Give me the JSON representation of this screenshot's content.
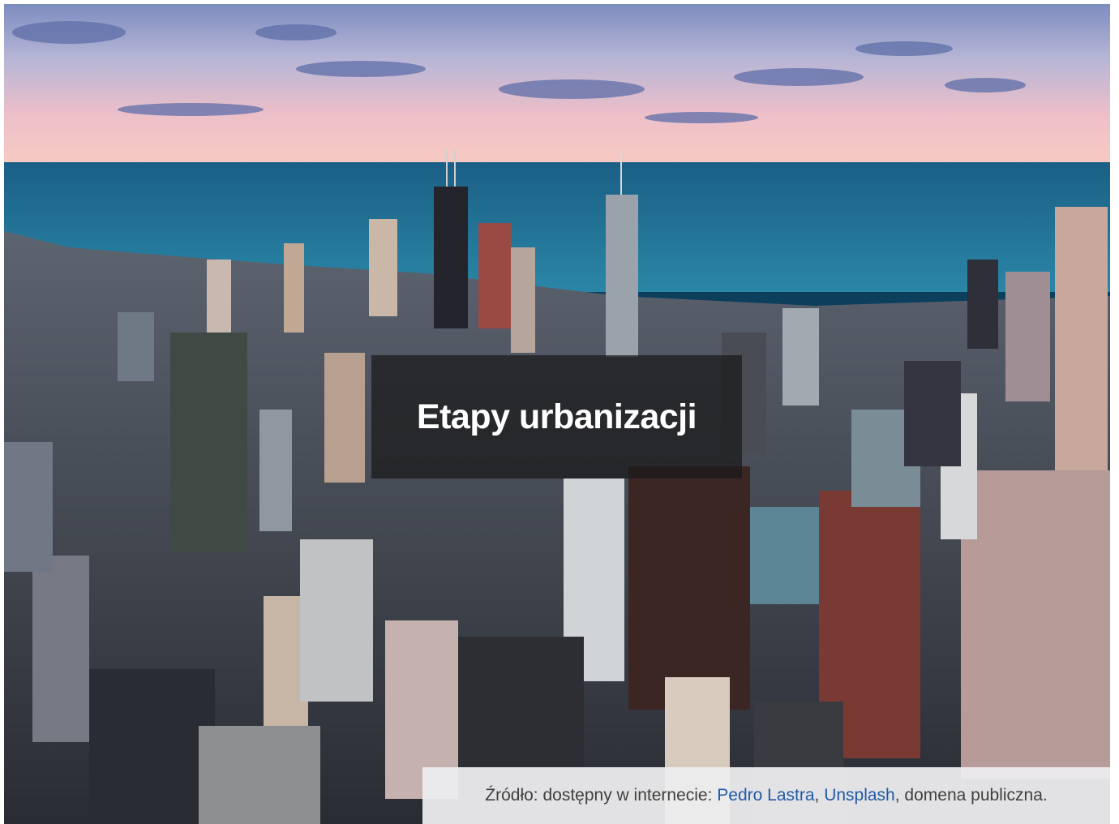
{
  "hero": {
    "image_alt": "aerial city skyline by the lake at sunset",
    "title": "Etapy urbanizacji"
  },
  "source": {
    "prefix": "Źródło: dostępny w internecie: ",
    "author_link": "Pedro Lastra",
    "separator": ", ",
    "site_link": "Unsplash",
    "suffix": ", domena publiczna."
  },
  "colors": {
    "sky_top": "#6f7fb3",
    "sky_horizon": "#f2b9bf",
    "lake": "#1f6f93",
    "title_box": "#191919",
    "source_box": "#ececee",
    "link": "#1f5aa8"
  }
}
